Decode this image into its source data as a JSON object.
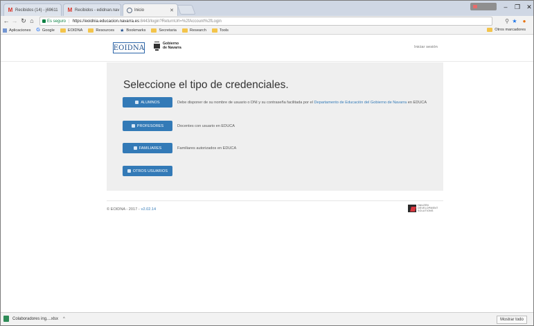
{
  "browser": {
    "tabs": [
      {
        "title": "Recibidos (14) - j69611",
        "icon": "gmail-icon"
      },
      {
        "title": "Recibidos - edidnan.nav",
        "icon": "gmail-icon"
      },
      {
        "title": "Inicio",
        "icon": "globe-icon"
      }
    ],
    "security_label": "Es seguro",
    "url_host": "https://eoidnia.educacion.navarra.es",
    "url_path": ":8443/login?ReturnUrl=%2fAccount%2fLogin",
    "bookmarks": [
      "Aplicaciones",
      "Google",
      "EOIDNA",
      "Resources",
      "Bookmarks",
      "Secretaria",
      "Research",
      "Tools"
    ],
    "other_bookmarks": "Otros marcadores"
  },
  "header": {
    "logo_text": "EOIDNA",
    "gov_line1": "Gobierno",
    "gov_line2": "de Navarra",
    "login_link": "Iniciar sesión"
  },
  "main": {
    "title": "Seleccione el tipo de credenciales.",
    "credentials": [
      {
        "label": "ALUMNOS",
        "desc_before": "Debe disponer de su nombre de usuario o DNI y su contraseña facilitada por el ",
        "desc_link": "Departamento de Educación del Gobierno de Navarra",
        "desc_after": " en EDUCA"
      },
      {
        "label": "PROFESORES",
        "desc_before": "Docentes con usuario en EDUCA",
        "desc_link": "",
        "desc_after": ""
      },
      {
        "label": "FAMILIARES",
        "desc_before": "Familiares autorizados en EDUCA",
        "desc_link": "",
        "desc_after": ""
      },
      {
        "label": "OTROS USUARIOS",
        "desc_before": "",
        "desc_link": "",
        "desc_after": ""
      }
    ]
  },
  "footer": {
    "copyright": "© EOIDNA - 2017 -",
    "version": "v2.02.14",
    "brand_line1": "HAUZEN",
    "brand_line2": "DEVELOPMENT",
    "brand_line3": "SOLUTIONS"
  },
  "downloads": {
    "file_name": "Colaboradores ing....xlsx",
    "show_all": "Mostrar todo"
  },
  "colors": {
    "accent": "#337ab7",
    "panel_bg": "#efefef"
  }
}
